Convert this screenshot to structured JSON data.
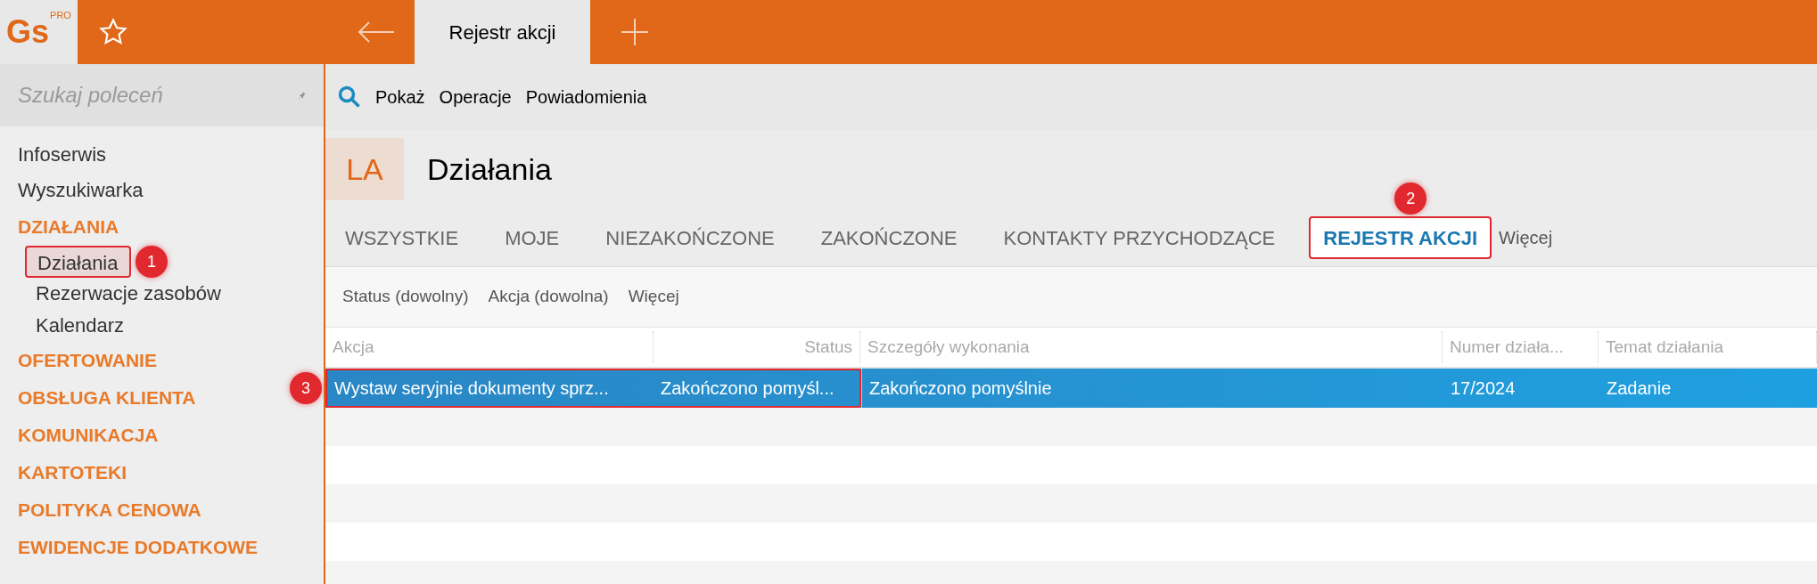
{
  "logo": {
    "text": "Gs",
    "sup": "PRO"
  },
  "window_tabs": [
    {
      "label": "Rejestr akcji",
      "selected": true
    }
  ],
  "sidebar": {
    "search": {
      "placeholder": "Szukaj poleceń"
    },
    "items": [
      {
        "kind": "link",
        "label": "Infoserwis"
      },
      {
        "kind": "link",
        "label": "Wyszukiwarka"
      },
      {
        "kind": "section",
        "label": "DZIAŁANIA",
        "children": [
          {
            "label": "Działania",
            "selected": true,
            "callout": "1"
          },
          {
            "label": "Rezerwacje zasobów",
            "selected": false
          },
          {
            "label": "Kalendarz",
            "selected": false
          }
        ]
      },
      {
        "kind": "section",
        "label": "OFERTOWANIE"
      },
      {
        "kind": "section",
        "label": "OBSŁUGA KLIENTA"
      },
      {
        "kind": "section",
        "label": "KOMUNIKACJA"
      },
      {
        "kind": "section",
        "label": "KARTOTEKI"
      },
      {
        "kind": "section",
        "label": "POLITYKA CENOWA"
      },
      {
        "kind": "section",
        "label": "EWIDENCJE DODATKOWE"
      }
    ]
  },
  "toolbar": [
    "Pokaż",
    "Operacje",
    "Powiadomienia"
  ],
  "header": {
    "badge": "LA",
    "title": "Działania"
  },
  "tabs": [
    {
      "label": "WSZYSTKIE",
      "selected": false
    },
    {
      "label": "MOJE",
      "selected": false
    },
    {
      "label": "NIEZAKOŃCZONE",
      "selected": false
    },
    {
      "label": "ZAKOŃCZONE",
      "selected": false
    },
    {
      "label": "KONTAKTY PRZYCHODZĄCE",
      "selected": false
    },
    {
      "label": "REJESTR AKCJI",
      "selected": true,
      "callout": "2"
    }
  ],
  "tabs_more": "Więcej",
  "filters": [
    "Status (dowolny)",
    "Akcja (dowolna)",
    "Więcej"
  ],
  "table": {
    "columns": [
      "Akcja",
      "Status",
      "Szczegóły wykonania",
      "Numer działa...",
      "Temat działania"
    ],
    "rows": [
      {
        "cells": [
          "Wystaw seryjnie dokumenty sprz...",
          "Zakończono pomyśl...",
          "Zakończono pomyślnie",
          "17/2024",
          "Zadanie"
        ],
        "selected": true,
        "callout": "3"
      }
    ]
  }
}
